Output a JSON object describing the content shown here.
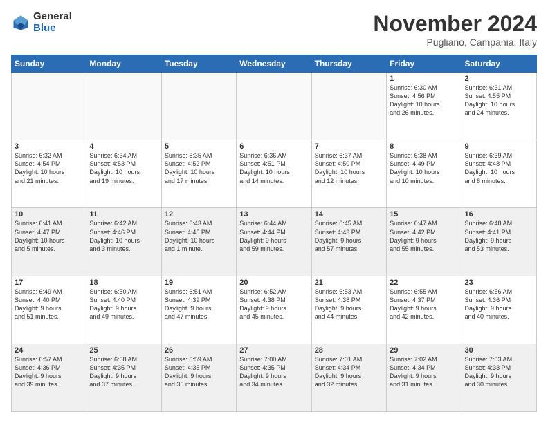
{
  "logo": {
    "general": "General",
    "blue": "Blue"
  },
  "header": {
    "month": "November 2024",
    "location": "Pugliano, Campania, Italy"
  },
  "days": [
    "Sunday",
    "Monday",
    "Tuesday",
    "Wednesday",
    "Thursday",
    "Friday",
    "Saturday"
  ],
  "weeks": [
    [
      {
        "day": "",
        "info": ""
      },
      {
        "day": "",
        "info": ""
      },
      {
        "day": "",
        "info": ""
      },
      {
        "day": "",
        "info": ""
      },
      {
        "day": "",
        "info": ""
      },
      {
        "day": "1",
        "info": "Sunrise: 6:30 AM\nSunset: 4:56 PM\nDaylight: 10 hours\nand 26 minutes."
      },
      {
        "day": "2",
        "info": "Sunrise: 6:31 AM\nSunset: 4:55 PM\nDaylight: 10 hours\nand 24 minutes."
      }
    ],
    [
      {
        "day": "3",
        "info": "Sunrise: 6:32 AM\nSunset: 4:54 PM\nDaylight: 10 hours\nand 21 minutes."
      },
      {
        "day": "4",
        "info": "Sunrise: 6:34 AM\nSunset: 4:53 PM\nDaylight: 10 hours\nand 19 minutes."
      },
      {
        "day": "5",
        "info": "Sunrise: 6:35 AM\nSunset: 4:52 PM\nDaylight: 10 hours\nand 17 minutes."
      },
      {
        "day": "6",
        "info": "Sunrise: 6:36 AM\nSunset: 4:51 PM\nDaylight: 10 hours\nand 14 minutes."
      },
      {
        "day": "7",
        "info": "Sunrise: 6:37 AM\nSunset: 4:50 PM\nDaylight: 10 hours\nand 12 minutes."
      },
      {
        "day": "8",
        "info": "Sunrise: 6:38 AM\nSunset: 4:49 PM\nDaylight: 10 hours\nand 10 minutes."
      },
      {
        "day": "9",
        "info": "Sunrise: 6:39 AM\nSunset: 4:48 PM\nDaylight: 10 hours\nand 8 minutes."
      }
    ],
    [
      {
        "day": "10",
        "info": "Sunrise: 6:41 AM\nSunset: 4:47 PM\nDaylight: 10 hours\nand 5 minutes."
      },
      {
        "day": "11",
        "info": "Sunrise: 6:42 AM\nSunset: 4:46 PM\nDaylight: 10 hours\nand 3 minutes."
      },
      {
        "day": "12",
        "info": "Sunrise: 6:43 AM\nSunset: 4:45 PM\nDaylight: 10 hours\nand 1 minute."
      },
      {
        "day": "13",
        "info": "Sunrise: 6:44 AM\nSunset: 4:44 PM\nDaylight: 9 hours\nand 59 minutes."
      },
      {
        "day": "14",
        "info": "Sunrise: 6:45 AM\nSunset: 4:43 PM\nDaylight: 9 hours\nand 57 minutes."
      },
      {
        "day": "15",
        "info": "Sunrise: 6:47 AM\nSunset: 4:42 PM\nDaylight: 9 hours\nand 55 minutes."
      },
      {
        "day": "16",
        "info": "Sunrise: 6:48 AM\nSunset: 4:41 PM\nDaylight: 9 hours\nand 53 minutes."
      }
    ],
    [
      {
        "day": "17",
        "info": "Sunrise: 6:49 AM\nSunset: 4:40 PM\nDaylight: 9 hours\nand 51 minutes."
      },
      {
        "day": "18",
        "info": "Sunrise: 6:50 AM\nSunset: 4:40 PM\nDaylight: 9 hours\nand 49 minutes."
      },
      {
        "day": "19",
        "info": "Sunrise: 6:51 AM\nSunset: 4:39 PM\nDaylight: 9 hours\nand 47 minutes."
      },
      {
        "day": "20",
        "info": "Sunrise: 6:52 AM\nSunset: 4:38 PM\nDaylight: 9 hours\nand 45 minutes."
      },
      {
        "day": "21",
        "info": "Sunrise: 6:53 AM\nSunset: 4:38 PM\nDaylight: 9 hours\nand 44 minutes."
      },
      {
        "day": "22",
        "info": "Sunrise: 6:55 AM\nSunset: 4:37 PM\nDaylight: 9 hours\nand 42 minutes."
      },
      {
        "day": "23",
        "info": "Sunrise: 6:56 AM\nSunset: 4:36 PM\nDaylight: 9 hours\nand 40 minutes."
      }
    ],
    [
      {
        "day": "24",
        "info": "Sunrise: 6:57 AM\nSunset: 4:36 PM\nDaylight: 9 hours\nand 39 minutes."
      },
      {
        "day": "25",
        "info": "Sunrise: 6:58 AM\nSunset: 4:35 PM\nDaylight: 9 hours\nand 37 minutes."
      },
      {
        "day": "26",
        "info": "Sunrise: 6:59 AM\nSunset: 4:35 PM\nDaylight: 9 hours\nand 35 minutes."
      },
      {
        "day": "27",
        "info": "Sunrise: 7:00 AM\nSunset: 4:35 PM\nDaylight: 9 hours\nand 34 minutes."
      },
      {
        "day": "28",
        "info": "Sunrise: 7:01 AM\nSunset: 4:34 PM\nDaylight: 9 hours\nand 32 minutes."
      },
      {
        "day": "29",
        "info": "Sunrise: 7:02 AM\nSunset: 4:34 PM\nDaylight: 9 hours\nand 31 minutes."
      },
      {
        "day": "30",
        "info": "Sunrise: 7:03 AM\nSunset: 4:33 PM\nDaylight: 9 hours\nand 30 minutes."
      }
    ]
  ]
}
